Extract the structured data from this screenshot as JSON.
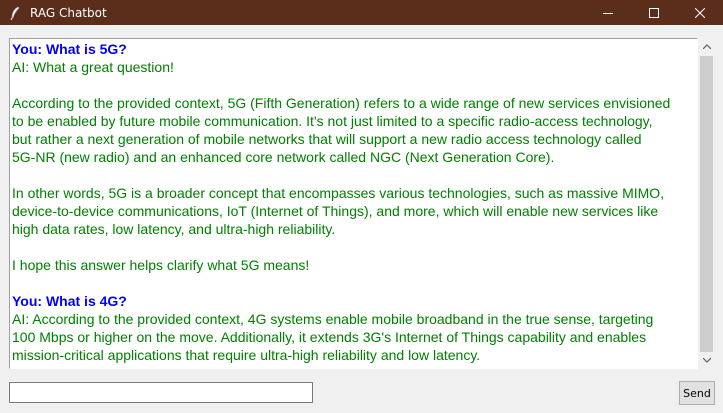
{
  "window": {
    "title": "RAG Chatbot"
  },
  "chat": {
    "q1": "You: What is 5G?",
    "a1_lines": [
      "AI: What a great question!",
      "",
      "According to the provided context, 5G (Fifth Generation) refers to a wide range of new services envisioned",
      "to be enabled by future mobile communication. It's not just limited to a specific radio-access technology,",
      "but rather a next generation of mobile networks that will support a new radio access technology called",
      "5G-NR (new radio) and an enhanced core network called NGC (Next Generation Core).",
      "",
      "In other words, 5G is a broader concept that encompasses various technologies, such as massive MIMO,",
      "device-to-device communications, IoT (Internet of Things), and more, which will enable new services like",
      "high data rates, low latency, and ultra-high reliability.",
      "",
      "I hope this answer helps clarify what 5G means!",
      ""
    ],
    "q2": "You: What is 4G?",
    "a2_lines": [
      "AI: According to the provided context, 4G systems enable mobile broadband in the true sense, targeting",
      "100 Mbps or higher on the move. Additionally, it extends 3G's Internet of Things capability and enables",
      "mission-critical applications that require ultra-high reliability and low latency."
    ]
  },
  "input": {
    "value": ""
  },
  "send_label": "Send",
  "colors": {
    "question": "#0000ff",
    "answer": "#008000",
    "titlebar": "#5a2e1b"
  }
}
